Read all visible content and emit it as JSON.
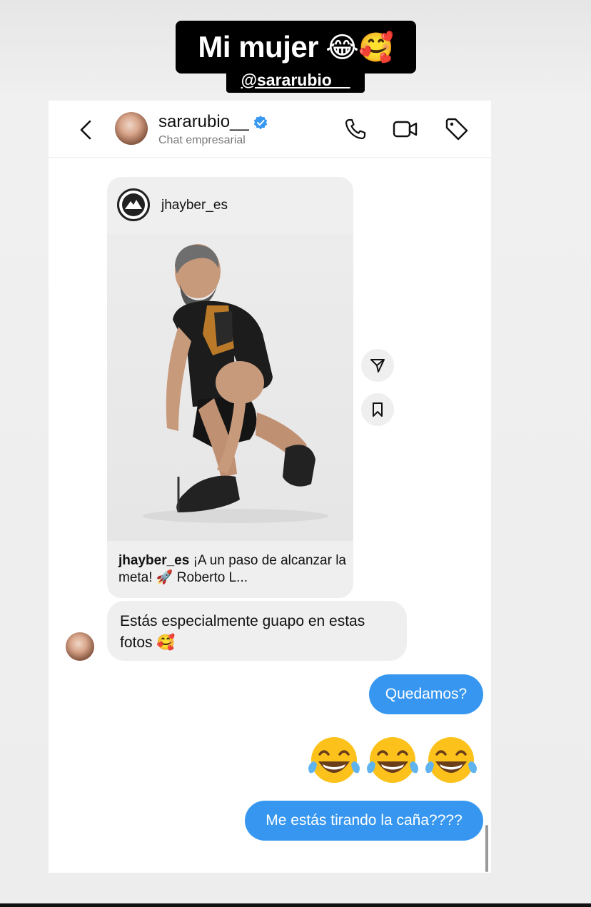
{
  "story": {
    "title": "Mi mujer",
    "title_emojis": "😂🥰",
    "mention": "@sararubio__"
  },
  "header": {
    "username": "sararubio__",
    "subtitle": "Chat empresarial"
  },
  "post": {
    "account": "jhayber_es",
    "caption_user": "jhayber_es",
    "caption_text": " ¡A un paso de alcanzar la meta! 🚀 Roberto L..."
  },
  "messages": {
    "incoming_text": "Estás especialmente guapo en estas fotos 🥰",
    "outgoing_1": "Quedamos?",
    "outgoing_3": "Me estás tirando la caña????"
  },
  "colors": {
    "accent": "#3797f0",
    "incoming_bg": "#efefef",
    "story_label_bg": "#000000",
    "verified": "#3897f0"
  },
  "icons": {
    "back": "chevron-left-icon",
    "call": "phone-icon",
    "video": "video-camera-icon",
    "tag": "tag-icon",
    "share": "paper-plane-icon",
    "save": "bookmark-icon",
    "laugh": "tears-of-joy-emoji"
  }
}
